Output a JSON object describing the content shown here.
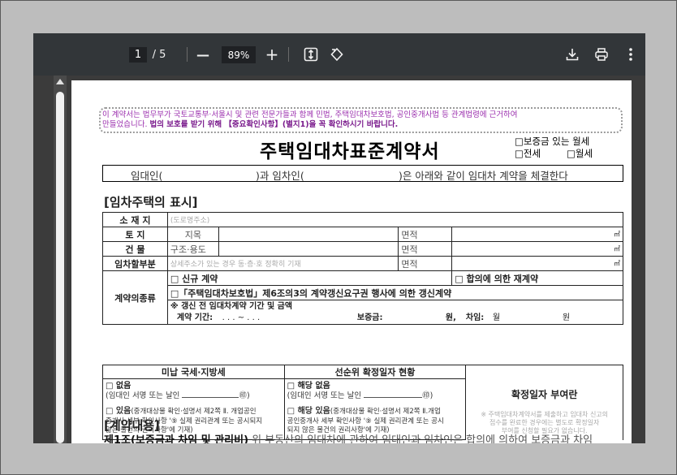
{
  "toolbar": {
    "page_current": "1",
    "page_total": "/ 5",
    "zoom": "89%",
    "zoom_out_glyph": "—",
    "zoom_in_glyph": "+",
    "icons": [
      "fit-page-icon",
      "rotate-icon",
      "download-icon",
      "print-icon",
      "more-vert-icon"
    ]
  },
  "doc": {
    "notice_line1": "이 계약서는 법무부가 국토교통부·서울시 및 관련 전문가들과 함께 민법, 주택임대차보호법, 공인중개사법 등 관계법령에 근거하여",
    "notice_line2a": "만들었습니다.",
    "notice_line2b": "법의 보호를 받기 위해 【중요확인사항】(별지1)을 꼭 확인하시기 바랍니다.",
    "title": "주택임대차표준계약서",
    "type_options": [
      "□보증금 있는 월세",
      "□전세",
      "□월세"
    ],
    "party_landlord": "임대인(",
    "party_and": ")과 임차인(",
    "party_suffix": ")은 아래와 같이 임대차 계약을 체결한다",
    "section_property": "[임차주택의 표시]",
    "row_location_label": "소 재 지",
    "row_location_hint": "(도로명주소)",
    "row_land_label": "토 지",
    "row_land_sub": "지목",
    "row_building_label": "건 물",
    "row_building_sub": "구조·용도",
    "row_lease_label": "임차할부분",
    "row_lease_hint": "상세주소가 있는 경우 동·층·호 정확히 기재",
    "area_label": "면적",
    "area_unit": "㎡",
    "contract_type_label": "계약의종류",
    "ct_new": "□ 신규 계약",
    "ct_agree": "□ 합의에 의한 재계약",
    "ct_renew": "□「주택임대차보호법」제6조의3의 계약갱신요구권 행사에 의한 갱신계약",
    "ct_prev": "※ 갱신 전 임대차계약 기간 및 금액",
    "ct_period": "계약 기간:",
    "ct_dots": ".     .     .   ~     .     .     .",
    "ct_deposit": "보증금:",
    "ct_won1": "원,",
    "ct_rent": "차임:",
    "ct_month": "월",
    "ct_won2": "원",
    "tax_header": "미납 국세·지방세",
    "priority_header": "선순위 확정일자 현황",
    "confirm_header": "확정일자 부여란",
    "tax_none": "□ 없음",
    "tax_none_sign": "(임대인 서명 또는 날인",
    "seal": "㊞)",
    "priority_none": "□ 해당 없음",
    "priority_none_sign": "(임대인 서명 또는 날인",
    "tax_yes": "□ 있음",
    "tax_yes_desc1": "(중개대상물 확인·설명서 제2쪽 Ⅱ. 개업공인",
    "tax_yes_desc2": "중개사 세부 확인사항 '⑨ 실제 권리관계 또는 공시되지",
    "tax_yes_desc3": "않은 물건의 권리사항'에 기재)",
    "priority_yes": "□ 해당 있음",
    "priority_yes_desc1": "(중개대상물 확인·설명서 제2쪽 Ⅱ.개업",
    "priority_yes_desc2": "공인중개사 세부 확인사항 '⑨ 실제 권리관계 또는 공시",
    "priority_yes_desc3": "되지 않은 물건의 권리사항'에 기재)",
    "confirm_note1": "※ 주택임대차계약서를 제출하고 임대차 신고의",
    "confirm_note2": "접수를 완료한 경우에는 별도로 확정일자",
    "confirm_note3": "부여를 신청할 필요가 없습니다.",
    "section_contract": "[계약내용]",
    "article1_title": "제1조(보증금과 차임 및 관리비)",
    "article1_text": "위 부동산의 임대차에 관하여 임대인과 임차인은 합의에 의하여 보증금과 차임"
  }
}
